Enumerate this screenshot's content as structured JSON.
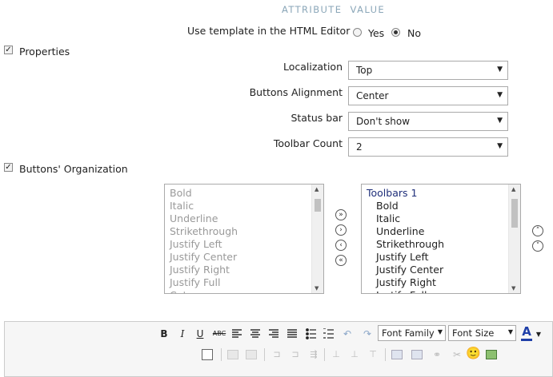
{
  "header": {
    "attribute": "ATTRIBUTE",
    "value": "VALUE"
  },
  "template_row": {
    "label": "Use template in the HTML Editor",
    "yes": "Yes",
    "no": "No",
    "selected": "No"
  },
  "properties": {
    "label": "Properties",
    "checked": true
  },
  "fields": [
    {
      "label": "Localization",
      "value": "Top"
    },
    {
      "label": "Buttons Alignment",
      "value": "Center"
    },
    {
      "label": "Status bar",
      "value": "Don't show"
    },
    {
      "label": "Toolbar Count",
      "value": "2"
    }
  ],
  "organization": {
    "label": "Buttons' Organization",
    "checked": true
  },
  "available_list": [
    "Bold",
    "Italic",
    "Underline",
    "Strikethrough",
    "Justify Left",
    "Justify Center",
    "Justify Right",
    "Justify Full",
    "Cut"
  ],
  "toolbar_list": {
    "group": "Toolbars 1",
    "items": [
      "Bold",
      "Italic",
      "Underline",
      "Strikethrough",
      "Justify Left",
      "Justify Center",
      "Justify Right",
      "Justify Full"
    ]
  },
  "transfer_buttons": {
    "all_right": "»",
    "right": "›",
    "left": "‹",
    "all_left": "«",
    "up": "˄",
    "down": "˅"
  },
  "editor": {
    "bold": "B",
    "italic": "I",
    "underline": "U",
    "strike": "ABC",
    "font_family": "Font Family",
    "font_size": "Font Size",
    "font_color": "A",
    "smiley": "🙂"
  },
  "colors": {
    "header": "#8aa6b8",
    "group": "#1f2f7a",
    "muted": "#999999"
  }
}
